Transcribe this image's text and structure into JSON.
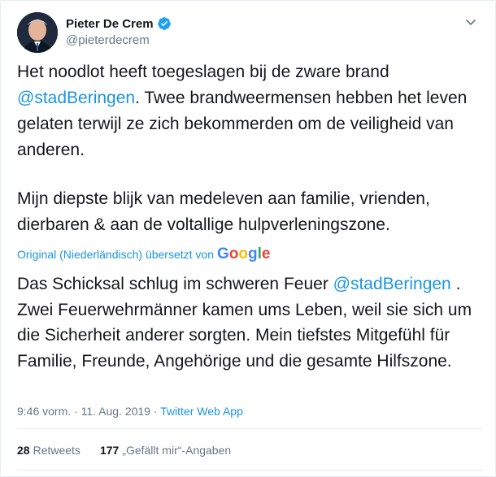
{
  "author": {
    "name": "Pieter De Crem",
    "handle": "@pieterdecrem"
  },
  "tweet": {
    "line1_pre": "Het noodlot heeft toegeslagen bij de zware brand ",
    "mention": "@stadBeringen",
    "line1_post": ". Twee brandweermensen hebben het leven gelaten terwijl ze zich bekommerden om de veiligheid van anderen.",
    "paragraph2": "Mijn diepste blijk van medeleven aan familie, vrienden, dierbaren & aan de voltallige hulpverleningszone."
  },
  "translation": {
    "notice": "Original (Niederländisch) übersetzt von",
    "provider": "Google",
    "text_pre": "Das Schicksal schlug im schweren Feuer ",
    "mention": "@stadBeringen",
    "text_post": " . Zwei Feuerwehrmänner kamen ums Leben, weil sie sich um die Sicherheit anderer sorgten. Mein tiefstes Mitgefühl für Familie, Freunde, Angehörige und die gesamte Hilfszone."
  },
  "meta": {
    "time": "9:46 vorm.",
    "separator": "·",
    "date": "11. Aug. 2019",
    "source": "Twitter Web App"
  },
  "stats": {
    "retweets_count": "28",
    "retweets_label": "Retweets",
    "likes_count": "177",
    "likes_label": "„Gefällt mir“-Angaben"
  },
  "colors": {
    "accent": "#1b95e0",
    "text": "#14171a",
    "muted": "#657786"
  }
}
